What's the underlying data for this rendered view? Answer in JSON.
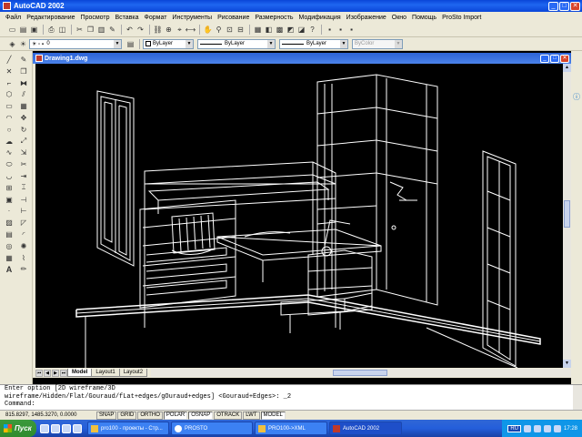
{
  "app": {
    "title": "AutoCAD 2002"
  },
  "menu": {
    "items": [
      "Файл",
      "Редактирование",
      "Просмотр",
      "Вставка",
      "Формат",
      "Инструменты",
      "Рисование",
      "Размерность",
      "Модификация",
      "Изображение",
      "Окно",
      "Помощь",
      "ProSto Import"
    ]
  },
  "properties": {
    "layer": "0",
    "color": "ByLayer",
    "linetype": "ByLayer",
    "lineweight": "ByLayer",
    "plotstyle": "ByColor"
  },
  "document": {
    "title": "Drawing1.dwg"
  },
  "layout_tabs": [
    "Model",
    "Layout1",
    "Layout2"
  ],
  "command_lines": [
    "Enter option [2D wireframe/3D",
    "wireframe/Hidden/Flat/Gouraud/fLat+edges/gOuraud+edges] <Gouraud+Edges>: _2",
    "Command:"
  ],
  "status": {
    "coords": "815.8297, 1485.3270, 0.0000",
    "toggles": [
      "SNAP",
      "GRID",
      "ORTHO",
      "POLAR",
      "OSNAP",
      "OTRACK",
      "LWT",
      "MODEL"
    ]
  },
  "taskbar": {
    "start": "Пуск",
    "tasks": [
      "pro100 - проекты - Стр...",
      "PROSTO",
      "PRO100->XML",
      "AutoCAD 2002"
    ],
    "language": "RU",
    "clock": "17:28"
  },
  "colors": {
    "titlebar": "#0a46d8",
    "chrome": "#ece9d8",
    "wireframe": "#ffffff",
    "taskbar": "#245edb"
  }
}
